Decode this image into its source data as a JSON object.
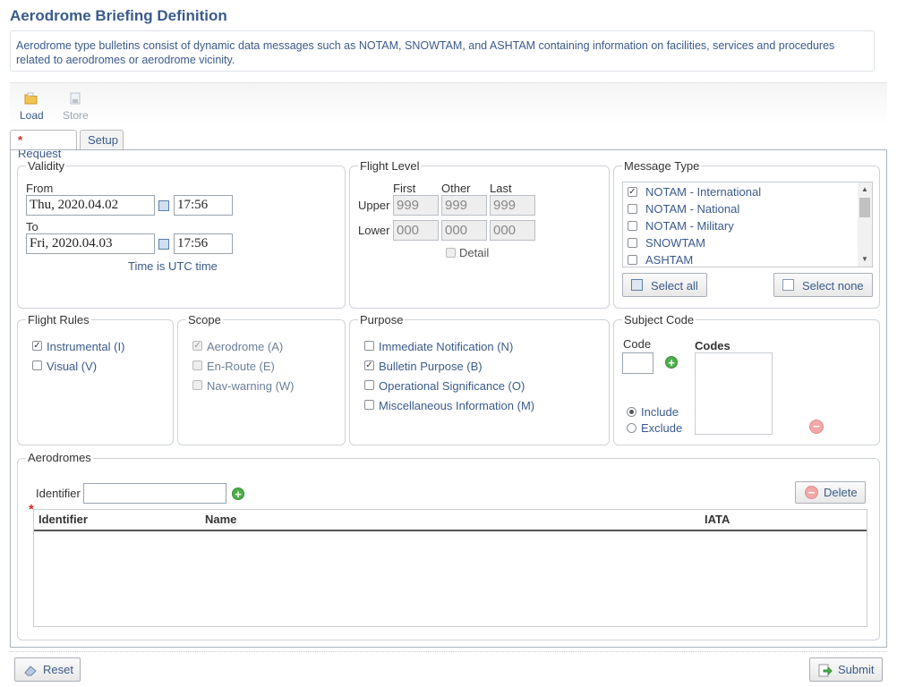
{
  "page": {
    "title": "Aerodrome Briefing Definition",
    "description": "Aerodrome type bulletins consist of dynamic data messages such as NOTAM, SNOWTAM, and ASHTAM containing information on facilities, services and procedures related to aerodromes or aerodrome vicinity."
  },
  "toolbar": {
    "load": "Load",
    "store": "Store"
  },
  "tabs": {
    "request": "Request",
    "setup": "Setup"
  },
  "validity": {
    "legend": "Validity",
    "from_label": "From",
    "from_date": "Thu, 2020.04.02",
    "from_time": "17:56",
    "to_label": "To",
    "to_date": "Fri, 2020.04.03",
    "to_time": "17:56",
    "utc_note": "Time is UTC time"
  },
  "flight_level": {
    "legend": "Flight Level",
    "col_first": "First",
    "col_other": "Other",
    "col_last": "Last",
    "upper_label": "Upper",
    "lower_label": "Lower",
    "upper": [
      "999",
      "999",
      "999"
    ],
    "lower": [
      "000",
      "000",
      "000"
    ],
    "detail_label": "Detail"
  },
  "message_type": {
    "legend": "Message Type",
    "items": [
      {
        "label": "NOTAM - International",
        "checked": true
      },
      {
        "label": "NOTAM - National",
        "checked": false
      },
      {
        "label": "NOTAM - Military",
        "checked": false
      },
      {
        "label": "SNOWTAM",
        "checked": false
      },
      {
        "label": "ASHTAM",
        "checked": false
      }
    ],
    "select_all": "Select all",
    "select_none": "Select none"
  },
  "flight_rules": {
    "legend": "Flight Rules",
    "instrumental": "Instrumental (I)",
    "visual": "Visual (V)"
  },
  "scope": {
    "legend": "Scope",
    "aerodrome": "Aerodrome (A)",
    "enroute": "En-Route (E)",
    "navwarning": "Nav-warning (W)"
  },
  "purpose": {
    "legend": "Purpose",
    "immediate": "Immediate Notification (N)",
    "bulletin": "Bulletin Purpose (B)",
    "operational": "Operational Significance (O)",
    "misc": "Miscellaneous Information (M)"
  },
  "subject_code": {
    "legend": "Subject Code",
    "code_label": "Code",
    "codes_label": "Codes",
    "include": "Include",
    "exclude": "Exclude"
  },
  "aerodromes": {
    "legend": "Aerodromes",
    "identifier_label": "Identifier",
    "delete": "Delete",
    "columns": {
      "identifier": "Identifier",
      "name": "Name",
      "iata": "IATA"
    }
  },
  "footer": {
    "reset": "Reset",
    "submit": "Submit"
  },
  "colors": {
    "accent": "#3a5b8c",
    "required": "#d9262a"
  }
}
